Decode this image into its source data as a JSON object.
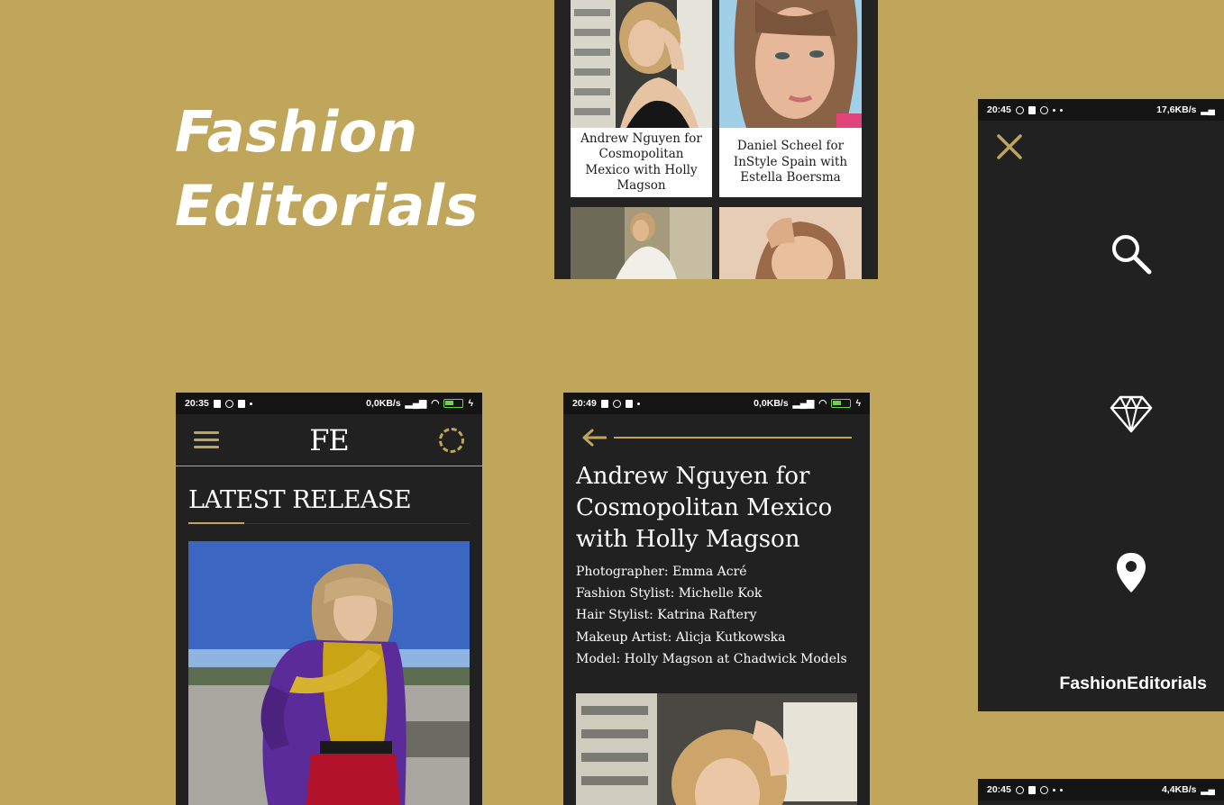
{
  "hero": {
    "line1": "Fashion",
    "line2": "Editorials"
  },
  "gallery": {
    "cards": [
      {
        "caption": "Andrew Nguyen for Cosmopolitan Mexico with Holly Magson"
      },
      {
        "caption": "Daniel Scheel for InStyle Spain with Estella Boersma"
      }
    ]
  },
  "home_screen": {
    "status": {
      "time": "20:35",
      "speed": "0,0KB/s",
      "battery": "50"
    },
    "logo": "FE",
    "section_title": "LATEST RELEASE"
  },
  "article_screen": {
    "status": {
      "time": "20:49",
      "speed": "0,0KB/s",
      "battery": "50"
    },
    "title": "Andrew Nguyen for Cosmopolitan Mexico with Holly Magson",
    "credits": [
      "Photographer: Emma Acré",
      "Fashion Stylist: Michelle Kok",
      "Hair Stylist: Katrina Raftery",
      "Makeup Artist: Alicja Kutkowska",
      "Model: Holly Magson at Chadwick Models"
    ]
  },
  "menu_screen": {
    "status": {
      "time": "20:45",
      "speed": "17,6KB/s"
    },
    "icons": [
      "search-icon",
      "diamond-icon",
      "location-pin-icon"
    ],
    "brand": "FashionEditorials"
  },
  "bottom_screen": {
    "status": {
      "time": "20:45",
      "speed": "4,4KB/s"
    }
  },
  "colors": {
    "background": "#bfa65b",
    "accent": "#bfa65b",
    "screen": "#212121",
    "statusbar": "#141414"
  }
}
